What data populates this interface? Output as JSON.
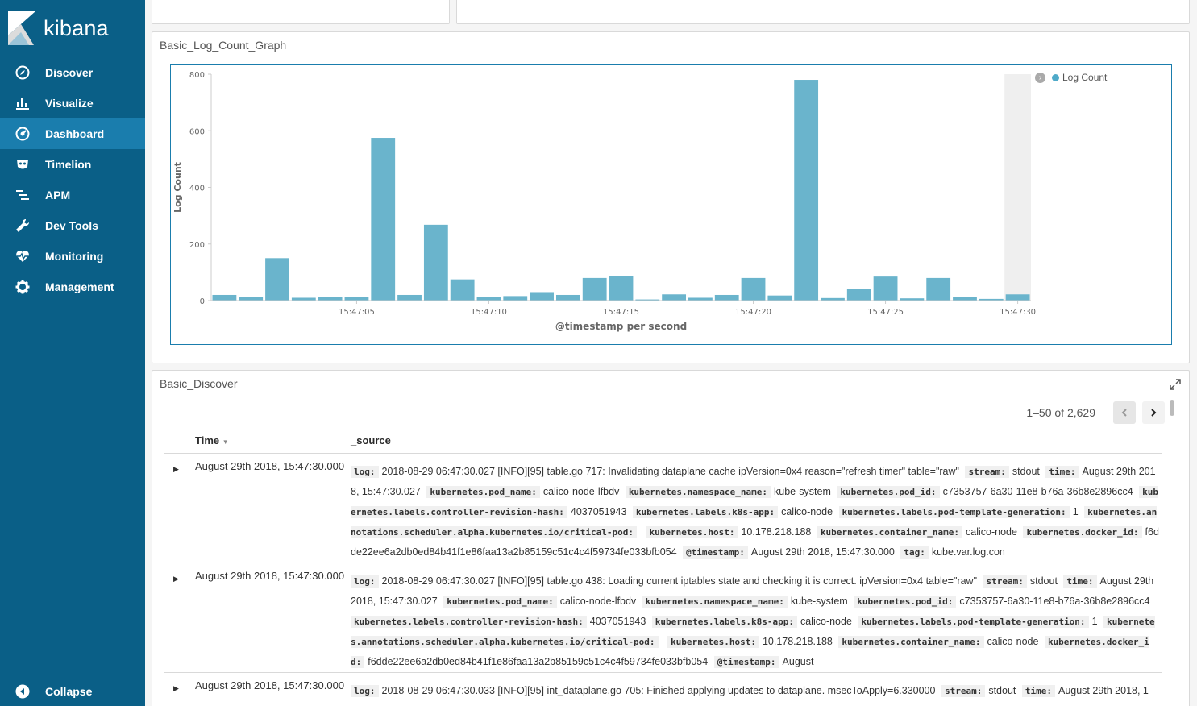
{
  "app": {
    "name": "kibana"
  },
  "sidebar": {
    "items": [
      {
        "label": "Discover",
        "icon": "compass-icon"
      },
      {
        "label": "Visualize",
        "icon": "bar-chart-icon"
      },
      {
        "label": "Dashboard",
        "icon": "dashboard-icon",
        "active": true
      },
      {
        "label": "Timelion",
        "icon": "timelion-icon"
      },
      {
        "label": "APM",
        "icon": "apm-icon"
      },
      {
        "label": "Dev Tools",
        "icon": "wrench-icon"
      },
      {
        "label": "Monitoring",
        "icon": "heartbeat-icon"
      },
      {
        "label": "Management",
        "icon": "gear-icon"
      }
    ],
    "collapse_label": "Collapse"
  },
  "graph_panel": {
    "title": "Basic_Log_Count_Graph"
  },
  "chart_data": {
    "type": "bar",
    "title": "",
    "xlabel": "@timestamp per second",
    "ylabel": "Log Count",
    "ylim": [
      0,
      800
    ],
    "yticks": [
      0,
      200,
      400,
      600,
      800
    ],
    "xticks": [
      "15:47:05",
      "15:47:10",
      "15:47:15",
      "15:47:20",
      "15:47:25",
      "15:47:30"
    ],
    "xtick_indices": [
      5,
      10,
      15,
      20,
      25,
      30
    ],
    "values": [
      20,
      12,
      150,
      10,
      14,
      14,
      575,
      20,
      268,
      75,
      14,
      16,
      30,
      20,
      80,
      87,
      4,
      22,
      10,
      20,
      80,
      18,
      780,
      9,
      42,
      85,
      8,
      80,
      14,
      6,
      22
    ],
    "highlight_index": 30,
    "series": [
      {
        "name": "Log Count",
        "color": "#6ab4cc"
      }
    ],
    "legend_position": "top-right",
    "legend_dot_color": "#4faac9"
  },
  "discover_panel": {
    "title": "Basic_Discover",
    "pager_text": "1–50 of 2,629",
    "columns": {
      "time": "Time",
      "source": "_source"
    },
    "rows": [
      {
        "time": "August 29th 2018, 15:47:30.000",
        "fields": [
          [
            "log:",
            "2018-08-29 06:47:30.027 [INFO][95] table.go 717: Invalidating dataplane cache ipVersion=0x4 reason=\"refresh timer\" table=\"raw\""
          ],
          [
            "stream:",
            "stdout"
          ],
          [
            "time:",
            "August 29th 2018, 15:47:30.027"
          ],
          [
            "kubernetes.pod_name:",
            "calico-node-lfbdv"
          ],
          [
            "kubernetes.namespace_name:",
            "kube-system"
          ],
          [
            "kubernetes.pod_id:",
            "c7353757-6a30-11e8-b76a-36b8e2896cc4"
          ],
          [
            "kubernetes.labels.controller-revision-hash:",
            "4037051943"
          ],
          [
            "kubernetes.labels.k8s-app:",
            "calico-node"
          ],
          [
            "kubernetes.labels.pod-template-generation:",
            "1"
          ],
          [
            "kubernetes.annotations.scheduler.alpha.kubernetes.io/critical-pod:",
            ""
          ],
          [
            "kubernetes.host:",
            "10.178.218.188"
          ],
          [
            "kubernetes.container_name:",
            "calico-node"
          ],
          [
            "kubernetes.docker_id:",
            "f6dde22ee6a2db0ed84b41f1e86faa13a2b85159c51c4c4f59734fe033bfb054"
          ],
          [
            "@timestamp:",
            "August 29th 2018, 15:47:30.000"
          ],
          [
            "tag:",
            "kube.var.log.con"
          ]
        ]
      },
      {
        "time": "August 29th 2018, 15:47:30.000",
        "fields": [
          [
            "log:",
            "2018-08-29 06:47:30.027 [INFO][95] table.go 438: Loading current iptables state and checking it is correct. ipVersion=0x4 table=\"raw\""
          ],
          [
            "stream:",
            "stdout"
          ],
          [
            "time:",
            "August 29th 2018, 15:47:30.027"
          ],
          [
            "kubernetes.pod_name:",
            "calico-node-lfbdv"
          ],
          [
            "kubernetes.namespace_name:",
            "kube-system"
          ],
          [
            "kubernetes.pod_id:",
            "c7353757-6a30-11e8-b76a-36b8e2896cc4"
          ],
          [
            "kubernetes.labels.controller-revision-hash:",
            "4037051943"
          ],
          [
            "kubernetes.labels.k8s-app:",
            "calico-node"
          ],
          [
            "kubernetes.labels.pod-template-generation:",
            "1"
          ],
          [
            "kubernetes.annotations.scheduler.alpha.kubernetes.io/critical-pod:",
            ""
          ],
          [
            "kubernetes.host:",
            "10.178.218.188"
          ],
          [
            "kubernetes.container_name:",
            "calico-node"
          ],
          [
            "kubernetes.docker_id:",
            "f6dde22ee6a2db0ed84b41f1e86faa13a2b85159c51c4c4f59734fe033bfb054"
          ],
          [
            "@timestamp:",
            "August"
          ]
        ]
      },
      {
        "time": "August 29th 2018, 15:47:30.000",
        "fields": [
          [
            "log:",
            "2018-08-29 06:47:30.033 [INFO][95] int_dataplane.go 705: Finished applying updates to dataplane. msecToApply=6.330000"
          ],
          [
            "stream:",
            "stdout"
          ],
          [
            "time:",
            "August 29th 2018, 1"
          ]
        ]
      }
    ]
  }
}
